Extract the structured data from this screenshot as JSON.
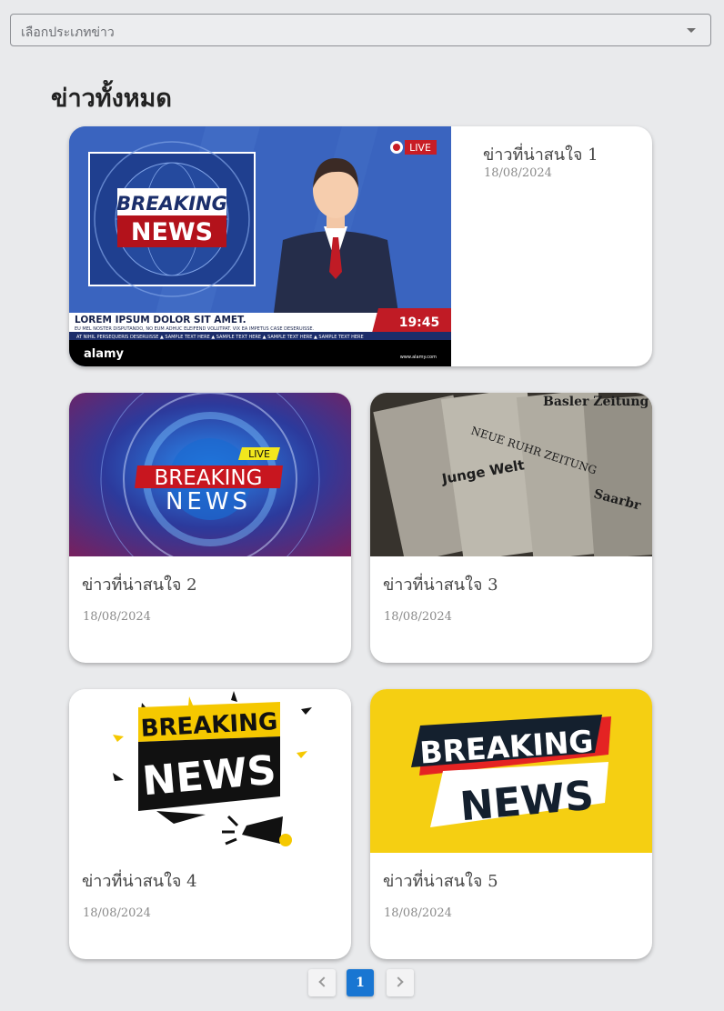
{
  "filter": {
    "placeholder": "เลือกประเภทข่าว"
  },
  "page_title": "ข่าวทั้งหมด",
  "news": [
    {
      "title": "ข่าวที่น่าสนใจ 1",
      "date": "18/08/2024",
      "image": "breaking-news-studio-anchor"
    },
    {
      "title": "ข่าวที่น่าสนใจ 2",
      "date": "18/08/2024",
      "image": "breaking-news-blue-globe"
    },
    {
      "title": "ข่าวที่น่าสนใจ 3",
      "date": "18/08/2024",
      "image": "newspaper-rack"
    },
    {
      "title": "ข่าวที่น่าสนใจ 4",
      "date": "18/08/2024",
      "image": "breaking-news-megaphone"
    },
    {
      "title": "ข่าวที่น่าสนใจ 5",
      "date": "18/08/2024",
      "image": "breaking-news-yellow-banner"
    }
  ],
  "images": {
    "img1": {
      "live": "LIVE",
      "l1": "BREAKING",
      "l2": "NEWS",
      "ticker": "LOREM IPSUM DOLOR SIT AMET.",
      "sub": "EU MEL NOSTER DISPUTANDO, NO EUM ADHUC ELEIFEND VOLUTPAT. VIX EA IMPETUS CASE DESERUISSE.",
      "time": "19:45",
      "crawl": "AT NIHIL PERSEQUERIS DESERUISSE  ▲ SAMPLE TEXT HERE  ▲ SAMPLE TEXT HERE  ▲ SAMPLE TEXT HERE  ▲ SAMPLE TEXT HERE",
      "brand": "alamy",
      "url": "www.alamy.com"
    },
    "img2": {
      "live": "LIVE",
      "l1": "BREAKING",
      "l2": "NEWS"
    },
    "img3": {
      "p1": "Basler Zeitung",
      "p2": "NEUE RUHR ZEITUNG",
      "p3": "Junge Welt",
      "p4": "Saarbr"
    },
    "img4": {
      "l1": "BREAKING",
      "l2": "NEWS"
    },
    "img5": {
      "l1": "BREAKING",
      "l2": "NEWS"
    }
  },
  "pagination": {
    "current": "1"
  }
}
